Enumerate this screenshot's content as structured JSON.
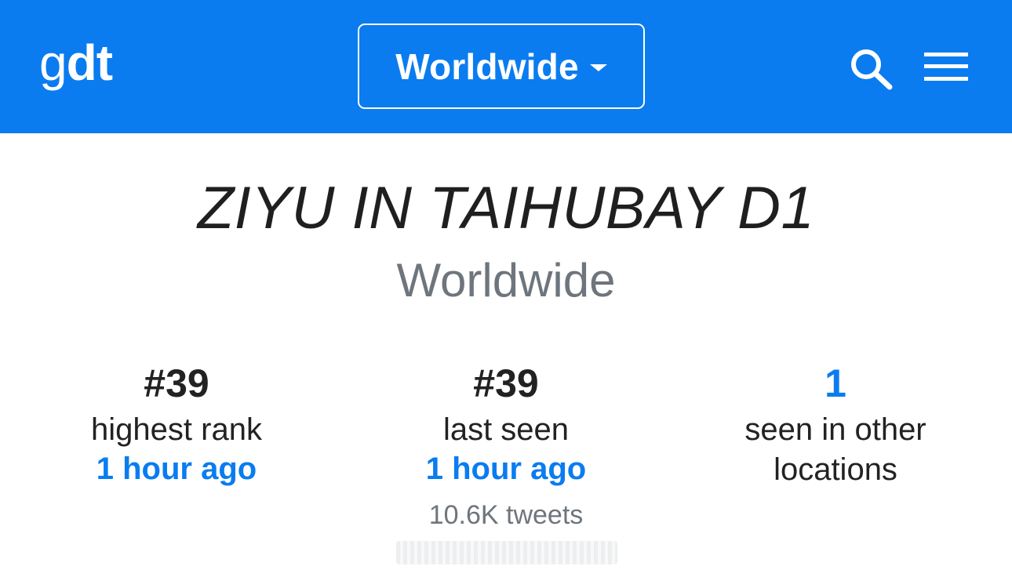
{
  "header": {
    "logo": {
      "part_light": "g",
      "part_bold": "dt"
    },
    "location_selector": {
      "label": "Worldwide"
    },
    "icons": {
      "search": "search-icon",
      "menu": "hamburger-menu-icon"
    }
  },
  "trend": {
    "title": "ZIYU IN TAIHUBAY D1",
    "location": "Worldwide"
  },
  "stats": [
    {
      "value": "#39",
      "label": "highest rank",
      "time": "1 hour ago"
    },
    {
      "value": "#39",
      "label": "last seen",
      "time": "1 hour ago",
      "tweets": "10.6K tweets"
    },
    {
      "value": "1",
      "label_line1": "seen in other",
      "label_line2": "locations"
    }
  ],
  "colors": {
    "brand_blue": "#0a7cf0",
    "text_dark": "#222222",
    "text_gray": "#6e757c"
  }
}
